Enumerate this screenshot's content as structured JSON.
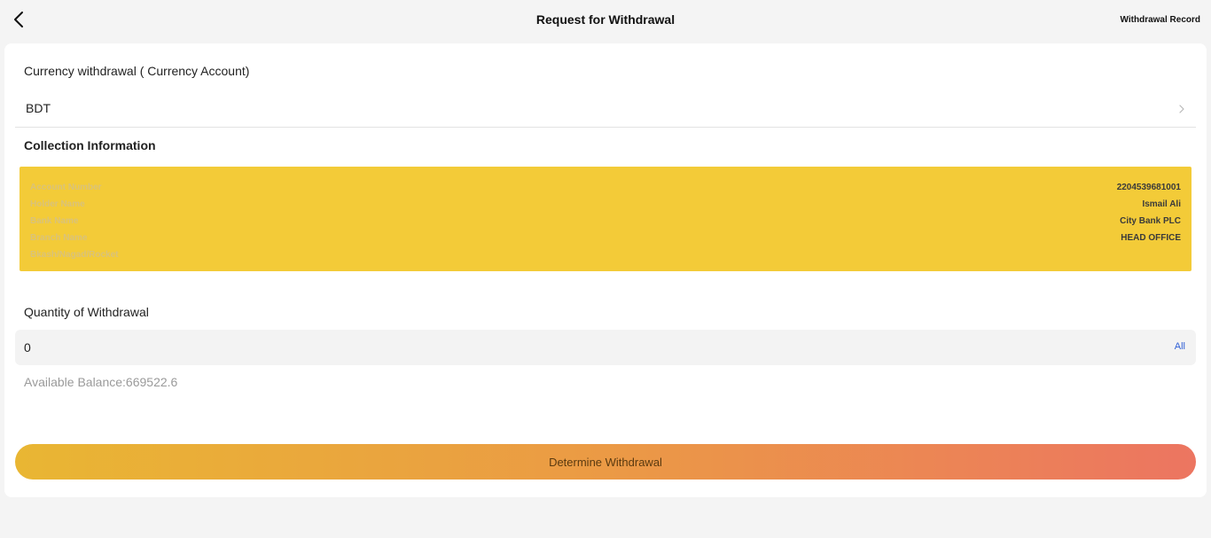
{
  "header": {
    "back_icon": "chevron-left-icon",
    "title": "Request for Withdrawal",
    "record_link": "Withdrawal Record"
  },
  "currency": {
    "label": "Currency withdrawal ( Currency Account)",
    "selected": "BDT",
    "chevron_icon": "chevron-right-icon"
  },
  "collection": {
    "title": "Collection Information",
    "box_color": "#f3cb38",
    "fields": [
      {
        "label": "Account Number",
        "value": "2204539681001"
      },
      {
        "label": "Holder Name",
        "value": "Ismail Ali"
      },
      {
        "label": "Bank Name",
        "value": "City Bank PLC"
      },
      {
        "label": "Branch Name",
        "value": "HEAD OFFICE"
      },
      {
        "label": "Bkash/Nagad/Rocket",
        "value": ""
      }
    ]
  },
  "withdrawal": {
    "label": "Quantity of Withdrawal",
    "value": "0",
    "all_label": "All",
    "balance_text": "Available Balance:669522.6"
  },
  "submit": {
    "label": "Determine Withdrawal",
    "gradient_start": "#e9b633",
    "gradient_end": "#ec7561"
  }
}
